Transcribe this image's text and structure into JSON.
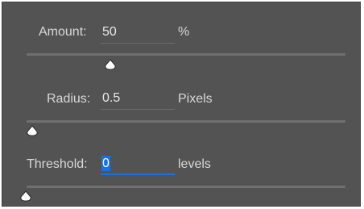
{
  "dialog": {
    "colors": {
      "panel_bg": "#535353",
      "text": "#d8d8d8",
      "track": "#707070",
      "focus_accent": "#1473e6",
      "thumb": "#ffffff"
    },
    "amount": {
      "label": "Amount:",
      "value": "50",
      "unit": "%",
      "slider_level_percent": 27
    },
    "radius": {
      "label": "Radius:",
      "value": "0.5",
      "unit": "Pixels",
      "slider_level_percent": 0
    },
    "threshold": {
      "label": "Threshold:",
      "value": "0",
      "unit": "levels",
      "slider_level_percent": 0,
      "focused": true
    },
    "thumb_icon": "slider-thumb-triangle"
  }
}
